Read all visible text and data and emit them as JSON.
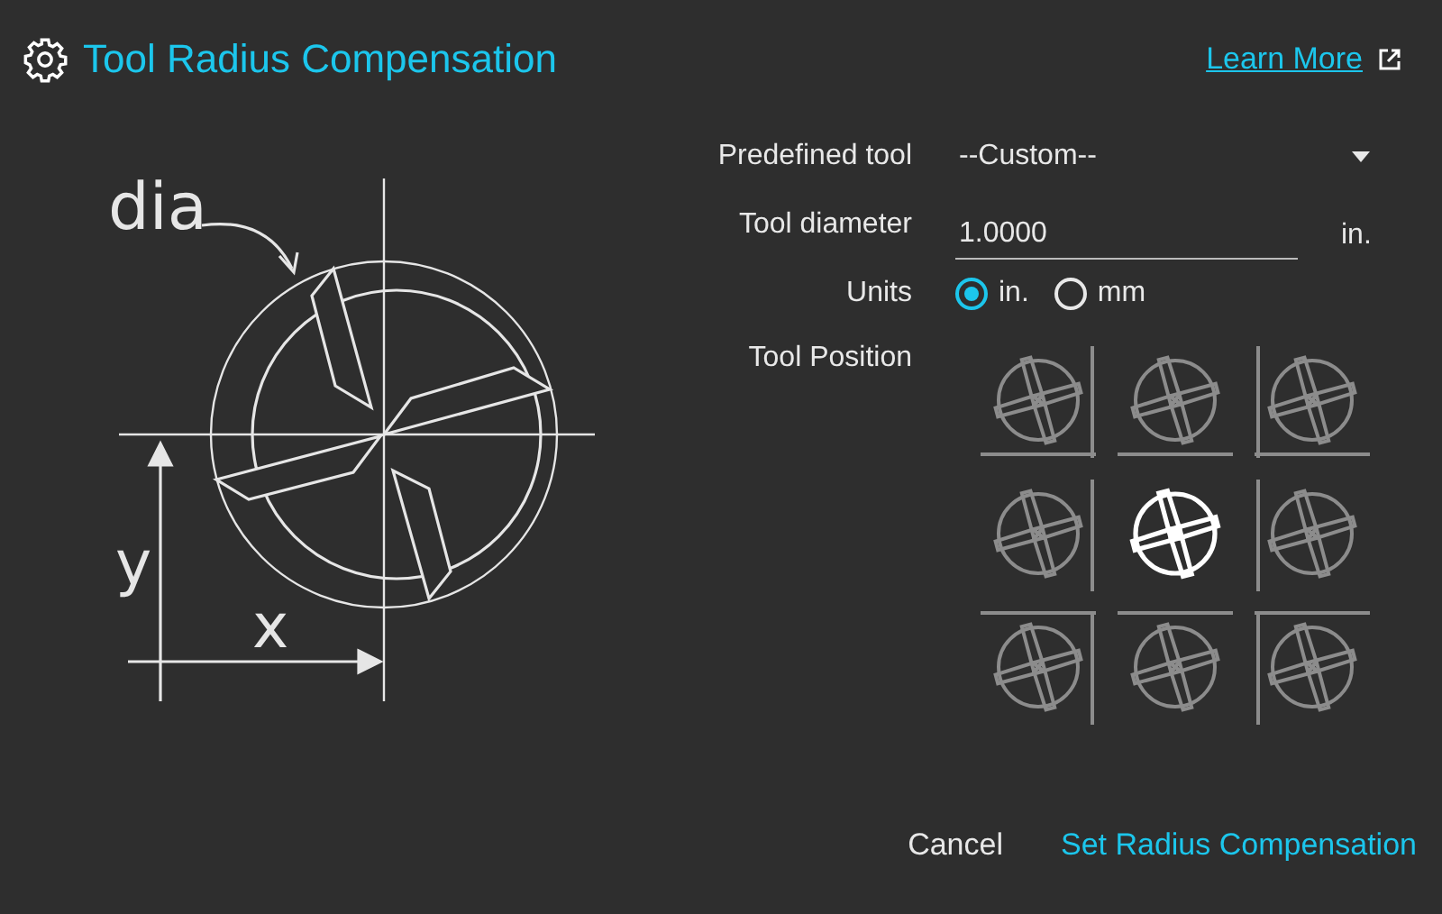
{
  "header": {
    "title": "Tool Radius Compensation",
    "link": "Learn More"
  },
  "diagram": {
    "diameter_label": "dia",
    "y_label": "y",
    "x_label": "x"
  },
  "form": {
    "predefined_tool": {
      "label": "Predefined tool",
      "value": "--Custom--"
    },
    "tool_diameter": {
      "label": "Tool diameter",
      "value": "1.0000",
      "unit": "in."
    },
    "units": {
      "label": "Units",
      "options": [
        {
          "label": "in.",
          "selected": true
        },
        {
          "label": "mm",
          "selected": false
        }
      ]
    },
    "tool_position": {
      "label": "Tool Position",
      "positions": [
        {
          "selected": false
        },
        {
          "selected": false
        },
        {
          "selected": false
        },
        {
          "selected": false
        },
        {
          "selected": true
        },
        {
          "selected": false
        },
        {
          "selected": false
        },
        {
          "selected": false
        },
        {
          "selected": false
        }
      ]
    }
  },
  "buttons": [
    {
      "label": "Cancel",
      "kind": "secondary"
    },
    {
      "label": "Set Radius Compensation",
      "kind": "primary"
    }
  ]
}
